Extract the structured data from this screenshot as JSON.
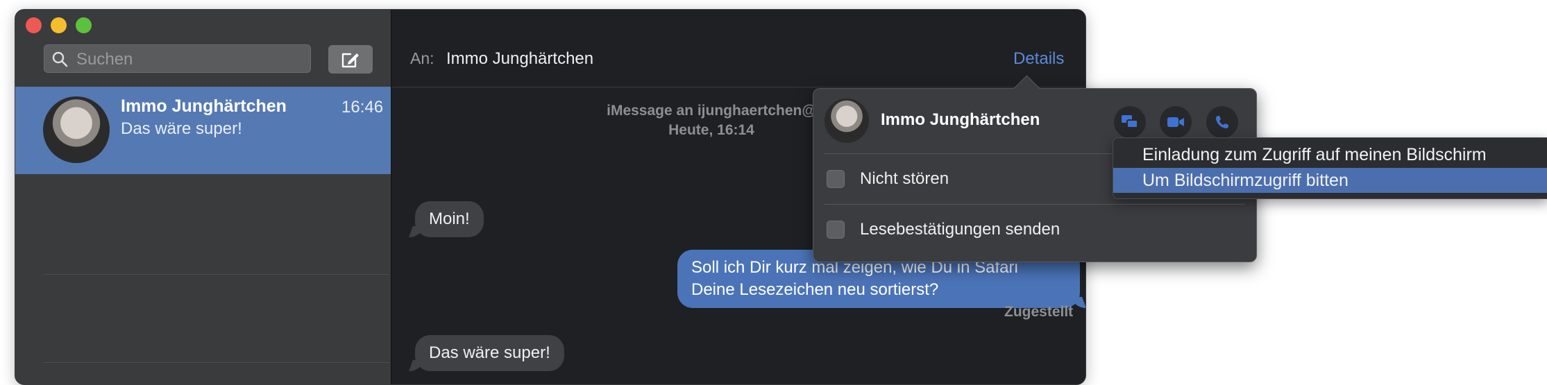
{
  "window": {
    "traffic_lights": [
      "close",
      "minimize",
      "maximize"
    ]
  },
  "sidebar": {
    "search": {
      "placeholder": "Suchen",
      "icon": "search-icon"
    },
    "compose_icon": "compose-icon",
    "conversations": [
      {
        "name": "Immo Junghärtchen",
        "time": "16:46",
        "snippet": "Das wäre super!",
        "selected": true
      }
    ]
  },
  "header": {
    "to_label": "An:",
    "recipient": "Immo Junghärtchen",
    "details_label": "Details"
  },
  "transcript": {
    "service_line": "iMessage an ijunghaertchen@",
    "date_line": "Heute, 16:14",
    "messages": [
      {
        "from": "them",
        "text": "Moin!"
      },
      {
        "from": "me",
        "line1": "Soll ich Dir kurz mal zeigen, wie Du in Safari",
        "line2": "Deine Lesezeichen neu sortierst?"
      },
      {
        "from": "them",
        "text": "Das wäre super!"
      }
    ],
    "status": "Zugestellt"
  },
  "details_popover": {
    "name": "Immo Junghärtchen",
    "actions": [
      "screen-share-icon",
      "video-call-icon",
      "phone-icon"
    ],
    "options": [
      {
        "label": "Nicht stören",
        "checked": false
      },
      {
        "label": "Lesebestätigungen senden",
        "checked": false
      }
    ]
  },
  "screen_share_menu": {
    "items": [
      {
        "label": "Einladung zum Zugriff auf meinen Bildschirm",
        "highlighted": false
      },
      {
        "label": "Um Bildschirmzugriff bitten",
        "highlighted": true
      }
    ]
  },
  "colors": {
    "accent": "#5579b3",
    "link": "#5c8bd8",
    "bubble_me": "#4b74b8",
    "bubble_them": "#3f4144"
  }
}
